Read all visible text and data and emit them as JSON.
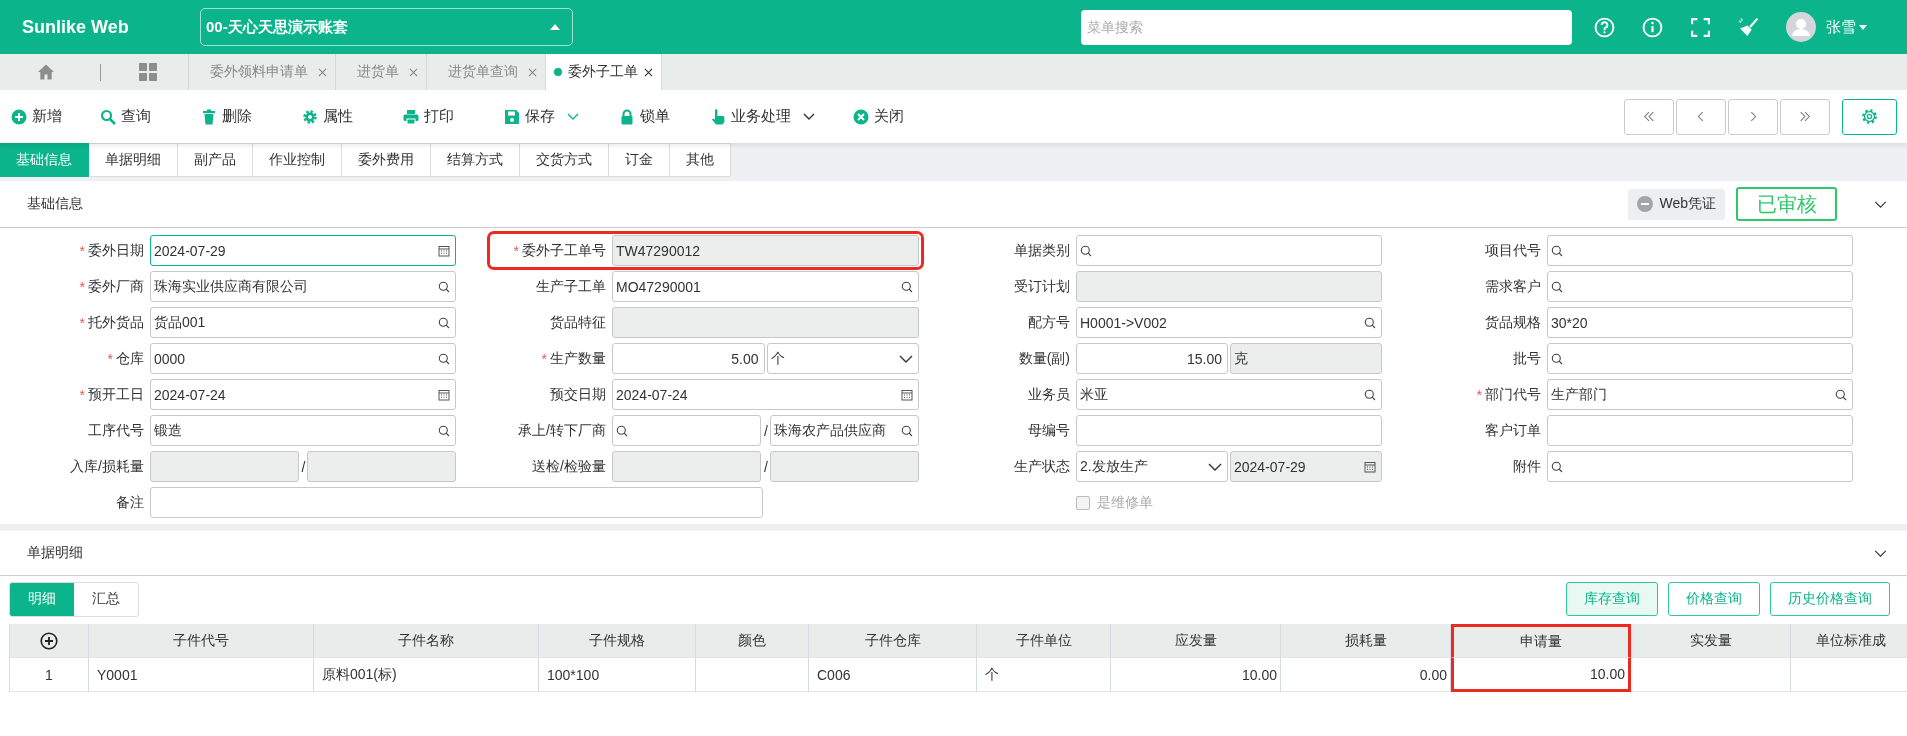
{
  "header": {
    "logo": "Sunlike Web",
    "account": "00-天心天思演示账套",
    "search_placeholder": "菜单搜索",
    "user": "张雪"
  },
  "open_tabs": [
    {
      "label": "委外领料申请单",
      "selected": false
    },
    {
      "label": "进货单",
      "selected": false
    },
    {
      "label": "进货单查询",
      "selected": false
    },
    {
      "label": "委外子工单",
      "selected": true
    }
  ],
  "toolbar": [
    {
      "label": "新增",
      "dropdown": false
    },
    {
      "label": "查询",
      "dropdown": false
    },
    {
      "label": "删除",
      "dropdown": false
    },
    {
      "label": "属性",
      "dropdown": false
    },
    {
      "label": "打印",
      "dropdown": false
    },
    {
      "label": "保存",
      "dropdown": true
    },
    {
      "label": "锁单",
      "dropdown": false
    },
    {
      "label": "业务处理",
      "dropdown": true
    },
    {
      "label": "关闭",
      "dropdown": false
    }
  ],
  "section_tabs": [
    {
      "label": "基础信息",
      "selected": true
    },
    {
      "label": "单据明细",
      "selected": false
    },
    {
      "label": "副产品",
      "selected": false
    },
    {
      "label": "作业控制",
      "selected": false
    },
    {
      "label": "委外费用",
      "selected": false
    },
    {
      "label": "结算方式",
      "selected": false
    },
    {
      "label": "交货方式",
      "selected": false
    },
    {
      "label": "订金",
      "selected": false
    },
    {
      "label": "其他",
      "selected": false
    }
  ],
  "basic_info": {
    "title": "基础信息",
    "voucher": "Web凭证",
    "status": "已审核",
    "expanded": true,
    "required_mark": "*",
    "fields": [
      {
        "label": "委外日期",
        "required": true,
        "inputs": [
          {
            "kind": "date",
            "value": "2024-07-29",
            "disabled": false,
            "focused": true
          }
        ]
      },
      {
        "label": "委外子工单号",
        "required": true,
        "highlighted": true,
        "inputs": [
          {
            "kind": "text",
            "value": "TW47290012",
            "disabled": true,
            "focused": false
          }
        ]
      },
      {
        "label": "单据类别",
        "required": false,
        "inputs": [
          {
            "kind": "lookup",
            "disabled": false,
            "focused": false
          }
        ]
      },
      {
        "label": "项目代号",
        "required": false,
        "inputs": [
          {
            "kind": "lookup",
            "disabled": false,
            "focused": false
          }
        ]
      },
      {
        "label": "委外厂商",
        "required": true,
        "inputs": [
          {
            "kind": "lookup",
            "value": "珠海实业供应商有限公司",
            "disabled": false,
            "focused": false
          }
        ]
      },
      {
        "label": "生产子工单",
        "required": false,
        "inputs": [
          {
            "kind": "lookup",
            "value": "MO47290001",
            "disabled": false,
            "focused": false
          }
        ]
      },
      {
        "label": "受订计划",
        "required": false,
        "inputs": [
          {
            "kind": "text",
            "disabled": true,
            "focused": false
          }
        ]
      },
      {
        "label": "需求客户",
        "required": false,
        "inputs": [
          {
            "kind": "lookup",
            "disabled": false,
            "focused": false
          }
        ]
      },
      {
        "label": "托外货品",
        "required": true,
        "inputs": [
          {
            "kind": "lookup",
            "value": "货品001",
            "disabled": false,
            "focused": false
          }
        ]
      },
      {
        "label": "货品特征",
        "required": false,
        "inputs": [
          {
            "kind": "text",
            "disabled": true,
            "focused": false
          }
        ]
      },
      {
        "label": "配方号",
        "required": false,
        "inputs": [
          {
            "kind": "lookup",
            "value": "H0001->V002",
            "disabled": false,
            "focused": false
          }
        ]
      },
      {
        "label": "货品规格",
        "required": false,
        "inputs": [
          {
            "kind": "text",
            "value": "30*20",
            "disabled": false,
            "focused": false
          }
        ]
      },
      {
        "label": "仓库",
        "required": true,
        "inputs": [
          {
            "kind": "lookup",
            "value": "0000",
            "disabled": false,
            "focused": false
          }
        ]
      },
      {
        "label": "生产数量",
        "required": true,
        "inputs": [
          {
            "kind": "number",
            "value": "5.00",
            "disabled": false,
            "focused": false
          },
          {
            "kind": "select",
            "value": "个",
            "disabled": false,
            "focused": false
          }
        ]
      },
      {
        "label": "数量(副)",
        "required": false,
        "inputs": [
          {
            "kind": "number",
            "value": "15.00",
            "disabled": false,
            "focused": false
          },
          {
            "kind": "text",
            "value": "克",
            "disabled": true,
            "focused": false
          }
        ]
      },
      {
        "label": "批号",
        "required": false,
        "inputs": [
          {
            "kind": "lookup",
            "disabled": false,
            "focused": false
          }
        ]
      },
      {
        "label": "预开工日",
        "required": true,
        "inputs": [
          {
            "kind": "date",
            "value": "2024-07-24",
            "disabled": false,
            "focused": false
          }
        ]
      },
      {
        "label": "预交日期",
        "required": false,
        "inputs": [
          {
            "kind": "date",
            "value": "2024-07-24",
            "disabled": false,
            "focused": false
          }
        ]
      },
      {
        "label": "业务员",
        "required": false,
        "inputs": [
          {
            "kind": "lookup",
            "value": "米亚",
            "disabled": false,
            "focused": false
          }
        ]
      },
      {
        "label": "部门代号",
        "required": true,
        "inputs": [
          {
            "kind": "lookup",
            "value": "生产部门",
            "disabled": false,
            "focused": false
          }
        ]
      },
      {
        "label": "工序代号",
        "required": false,
        "inputs": [
          {
            "kind": "lookup",
            "value": "锻造",
            "disabled": false,
            "focused": false
          }
        ]
      },
      {
        "label": "承上/转下厂商",
        "required": false,
        "separator": "/",
        "inputs": [
          {
            "kind": "lookup",
            "disabled": false,
            "focused": false
          },
          {
            "kind": "lookup",
            "value": "珠海农产品供应商",
            "disabled": false,
            "focused": false
          }
        ]
      },
      {
        "label": "母编号",
        "required": false,
        "inputs": [
          {
            "kind": "text",
            "disabled": false,
            "focused": false
          }
        ]
      },
      {
        "label": "客户订单",
        "required": false,
        "inputs": [
          {
            "kind": "text",
            "disabled": false,
            "focused": false
          }
        ]
      },
      {
        "label": "入库/损耗量",
        "required": false,
        "separator": "/",
        "inputs": [
          {
            "kind": "text",
            "disabled": true,
            "focused": false
          },
          {
            "kind": "text",
            "disabled": true,
            "focused": false
          }
        ]
      },
      {
        "label": "送检/检验量",
        "required": false,
        "separator": "/",
        "inputs": [
          {
            "kind": "text",
            "disabled": true,
            "focused": false
          },
          {
            "kind": "text",
            "disabled": true,
            "focused": false
          }
        ]
      },
      {
        "label": "生产状态",
        "required": false,
        "inputs": [
          {
            "kind": "select",
            "value": "2.发放生产",
            "disabled": false,
            "focused": false
          },
          {
            "kind": "date",
            "value": "2024-07-29",
            "disabled": true,
            "focused": false
          }
        ]
      },
      {
        "label": "附件",
        "required": false,
        "inputs": [
          {
            "kind": "lookup",
            "disabled": false,
            "focused": false
          }
        ]
      }
    ],
    "remark": {
      "label": "备注"
    },
    "repair_checkbox": {
      "label": "是维修单",
      "checked": false,
      "disabled": true
    }
  },
  "details": {
    "title": "单据明细",
    "expanded": true,
    "tabs": [
      {
        "label": "明细",
        "selected": true
      },
      {
        "label": "汇总",
        "selected": false
      }
    ],
    "buttons": [
      {
        "label": "库存查询",
        "selected": true
      },
      {
        "label": "价格查询",
        "selected": false
      },
      {
        "label": "历史价格查询",
        "selected": false
      }
    ],
    "columns": [
      {
        "kind": "add"
      },
      {
        "kind": "text",
        "label": "子件代号"
      },
      {
        "kind": "text",
        "label": "子件名称"
      },
      {
        "kind": "text",
        "label": "子件规格"
      },
      {
        "kind": "text",
        "label": "颜色"
      },
      {
        "kind": "text",
        "label": "子件仓库"
      },
      {
        "kind": "text",
        "label": "子件单位"
      },
      {
        "kind": "number",
        "label": "应发量"
      },
      {
        "kind": "number",
        "label": "损耗量"
      },
      {
        "kind": "number",
        "label": "申请量",
        "highlighted": true
      },
      {
        "kind": "number",
        "label": "实发量"
      },
      {
        "kind": "number",
        "label": "单位标准成"
      }
    ],
    "rows": [
      {
        "cells": [
          "1",
          "Y0001",
          "原料001(标)",
          "100*100",
          "",
          "C006",
          "个",
          "10.00",
          "0.00",
          "10.00",
          "",
          ""
        ]
      }
    ]
  }
}
